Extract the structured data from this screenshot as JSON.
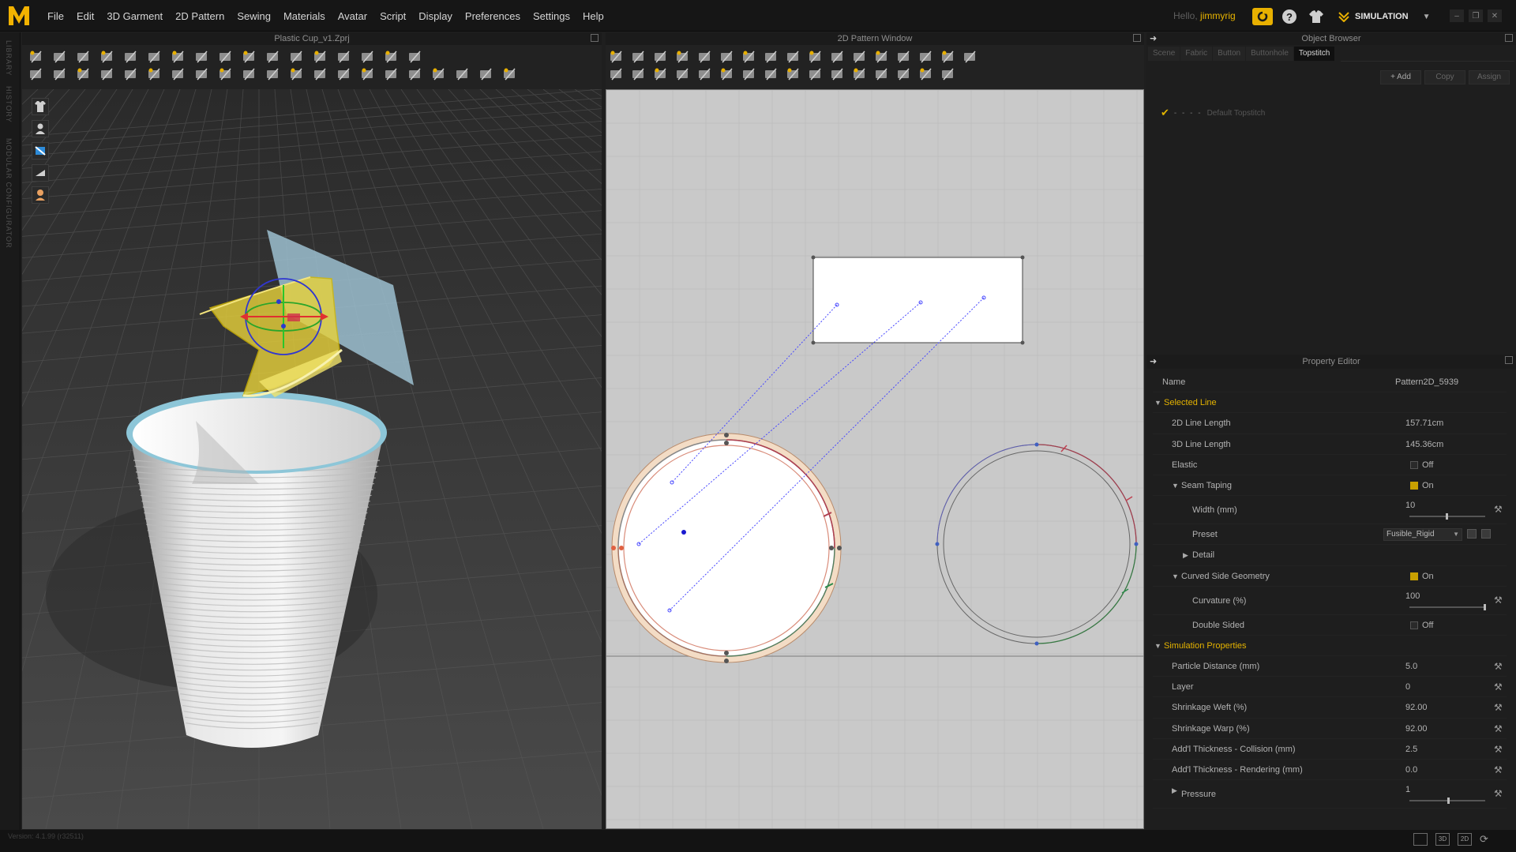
{
  "app": {
    "menu": [
      "File",
      "Edit",
      "3D Garment",
      "2D Pattern",
      "Sewing",
      "Materials",
      "Avatar",
      "Script",
      "Display",
      "Preferences",
      "Settings",
      "Help"
    ],
    "greeting": "Hello,",
    "username": "jimmyrig",
    "mode": "SIMULATION",
    "version": "Version: 4.1.99 (r32511)"
  },
  "side_rail": [
    "LIBRARY",
    "HISTORY",
    "MODULAR CONFIGURATOR"
  ],
  "view3d": {
    "title": "Plastic Cup_v1.Zprj"
  },
  "view2d": {
    "title": "2D Pattern Window"
  },
  "object_browser": {
    "title": "Object Browser",
    "tabs": [
      "Scene",
      "Fabric",
      "Button",
      "Buttonhole",
      "Topstitch"
    ],
    "active_tab": "Topstitch",
    "actions": {
      "add": "+ Add",
      "copy": "Copy",
      "assign": "Assign"
    },
    "items": [
      {
        "label": "Default Topstitch",
        "checked": true
      }
    ]
  },
  "property_editor": {
    "title": "Property Editor",
    "name_label": "Name",
    "name_value": "Pattern2D_5939",
    "selected_line": {
      "section": "Selected Line",
      "line_2d_label": "2D Line Length",
      "line_2d_value": "157.71cm",
      "line_3d_label": "3D Line Length",
      "line_3d_value": "145.36cm",
      "elastic_label": "Elastic",
      "elastic_value": "Off",
      "seam_taping_label": "Seam Taping",
      "seam_taping_value": "On",
      "width_label": "Width (mm)",
      "width_value": "10",
      "preset_label": "Preset",
      "preset_value": "Fusible_Rigid",
      "detail_label": "Detail",
      "curved_label": "Curved Side Geometry",
      "curved_value": "On",
      "curvature_label": "Curvature (%)",
      "curvature_value": "100",
      "double_sided_label": "Double Sided",
      "double_sided_value": "Off"
    },
    "simulation": {
      "section": "Simulation Properties",
      "particle_label": "Particle Distance (mm)",
      "particle_value": "5.0",
      "layer_label": "Layer",
      "layer_value": "0",
      "weft_label": "Shrinkage Weft (%)",
      "weft_value": "92.00",
      "warp_label": "Shrinkage Warp (%)",
      "warp_value": "92.00",
      "collision_label": "Add'l Thickness - Collision (mm)",
      "collision_value": "2.5",
      "rendering_label": "Add'l Thickness - Rendering (mm)",
      "rendering_value": "0.0",
      "pressure_label": "Pressure",
      "pressure_value": "1"
    }
  },
  "statusbar": {
    "view_buttons": [
      "",
      "3D",
      "2D"
    ]
  },
  "colors": {
    "accent": "#e5b300",
    "panel": "#1e1e1e",
    "pattern_bg": "#c9c9c9"
  }
}
